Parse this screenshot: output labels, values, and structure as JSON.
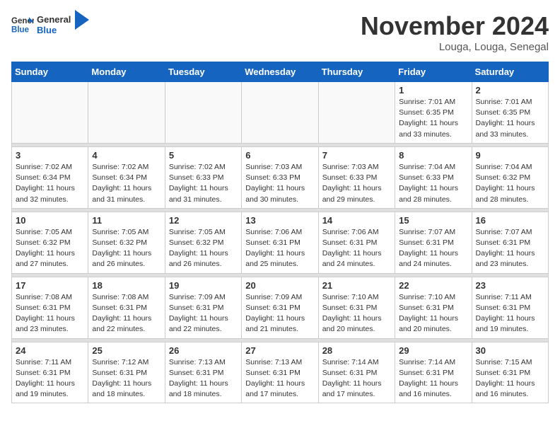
{
  "header": {
    "logo_line1": "General",
    "logo_line2": "Blue",
    "month_title": "November 2024",
    "location": "Louga, Louga, Senegal"
  },
  "weekdays": [
    "Sunday",
    "Monday",
    "Tuesday",
    "Wednesday",
    "Thursday",
    "Friday",
    "Saturday"
  ],
  "weeks": [
    [
      {
        "day": "",
        "info": ""
      },
      {
        "day": "",
        "info": ""
      },
      {
        "day": "",
        "info": ""
      },
      {
        "day": "",
        "info": ""
      },
      {
        "day": "",
        "info": ""
      },
      {
        "day": "1",
        "info": "Sunrise: 7:01 AM\nSunset: 6:35 PM\nDaylight: 11 hours\nand 33 minutes."
      },
      {
        "day": "2",
        "info": "Sunrise: 7:01 AM\nSunset: 6:35 PM\nDaylight: 11 hours\nand 33 minutes."
      }
    ],
    [
      {
        "day": "3",
        "info": "Sunrise: 7:02 AM\nSunset: 6:34 PM\nDaylight: 11 hours\nand 32 minutes."
      },
      {
        "day": "4",
        "info": "Sunrise: 7:02 AM\nSunset: 6:34 PM\nDaylight: 11 hours\nand 31 minutes."
      },
      {
        "day": "5",
        "info": "Sunrise: 7:02 AM\nSunset: 6:33 PM\nDaylight: 11 hours\nand 31 minutes."
      },
      {
        "day": "6",
        "info": "Sunrise: 7:03 AM\nSunset: 6:33 PM\nDaylight: 11 hours\nand 30 minutes."
      },
      {
        "day": "7",
        "info": "Sunrise: 7:03 AM\nSunset: 6:33 PM\nDaylight: 11 hours\nand 29 minutes."
      },
      {
        "day": "8",
        "info": "Sunrise: 7:04 AM\nSunset: 6:33 PM\nDaylight: 11 hours\nand 28 minutes."
      },
      {
        "day": "9",
        "info": "Sunrise: 7:04 AM\nSunset: 6:32 PM\nDaylight: 11 hours\nand 28 minutes."
      }
    ],
    [
      {
        "day": "10",
        "info": "Sunrise: 7:05 AM\nSunset: 6:32 PM\nDaylight: 11 hours\nand 27 minutes."
      },
      {
        "day": "11",
        "info": "Sunrise: 7:05 AM\nSunset: 6:32 PM\nDaylight: 11 hours\nand 26 minutes."
      },
      {
        "day": "12",
        "info": "Sunrise: 7:05 AM\nSunset: 6:32 PM\nDaylight: 11 hours\nand 26 minutes."
      },
      {
        "day": "13",
        "info": "Sunrise: 7:06 AM\nSunset: 6:31 PM\nDaylight: 11 hours\nand 25 minutes."
      },
      {
        "day": "14",
        "info": "Sunrise: 7:06 AM\nSunset: 6:31 PM\nDaylight: 11 hours\nand 24 minutes."
      },
      {
        "day": "15",
        "info": "Sunrise: 7:07 AM\nSunset: 6:31 PM\nDaylight: 11 hours\nand 24 minutes."
      },
      {
        "day": "16",
        "info": "Sunrise: 7:07 AM\nSunset: 6:31 PM\nDaylight: 11 hours\nand 23 minutes."
      }
    ],
    [
      {
        "day": "17",
        "info": "Sunrise: 7:08 AM\nSunset: 6:31 PM\nDaylight: 11 hours\nand 23 minutes."
      },
      {
        "day": "18",
        "info": "Sunrise: 7:08 AM\nSunset: 6:31 PM\nDaylight: 11 hours\nand 22 minutes."
      },
      {
        "day": "19",
        "info": "Sunrise: 7:09 AM\nSunset: 6:31 PM\nDaylight: 11 hours\nand 22 minutes."
      },
      {
        "day": "20",
        "info": "Sunrise: 7:09 AM\nSunset: 6:31 PM\nDaylight: 11 hours\nand 21 minutes."
      },
      {
        "day": "21",
        "info": "Sunrise: 7:10 AM\nSunset: 6:31 PM\nDaylight: 11 hours\nand 20 minutes."
      },
      {
        "day": "22",
        "info": "Sunrise: 7:10 AM\nSunset: 6:31 PM\nDaylight: 11 hours\nand 20 minutes."
      },
      {
        "day": "23",
        "info": "Sunrise: 7:11 AM\nSunset: 6:31 PM\nDaylight: 11 hours\nand 19 minutes."
      }
    ],
    [
      {
        "day": "24",
        "info": "Sunrise: 7:11 AM\nSunset: 6:31 PM\nDaylight: 11 hours\nand 19 minutes."
      },
      {
        "day": "25",
        "info": "Sunrise: 7:12 AM\nSunset: 6:31 PM\nDaylight: 11 hours\nand 18 minutes."
      },
      {
        "day": "26",
        "info": "Sunrise: 7:13 AM\nSunset: 6:31 PM\nDaylight: 11 hours\nand 18 minutes."
      },
      {
        "day": "27",
        "info": "Sunrise: 7:13 AM\nSunset: 6:31 PM\nDaylight: 11 hours\nand 17 minutes."
      },
      {
        "day": "28",
        "info": "Sunrise: 7:14 AM\nSunset: 6:31 PM\nDaylight: 11 hours\nand 17 minutes."
      },
      {
        "day": "29",
        "info": "Sunrise: 7:14 AM\nSunset: 6:31 PM\nDaylight: 11 hours\nand 16 minutes."
      },
      {
        "day": "30",
        "info": "Sunrise: 7:15 AM\nSunset: 6:31 PM\nDaylight: 11 hours\nand 16 minutes."
      }
    ]
  ]
}
